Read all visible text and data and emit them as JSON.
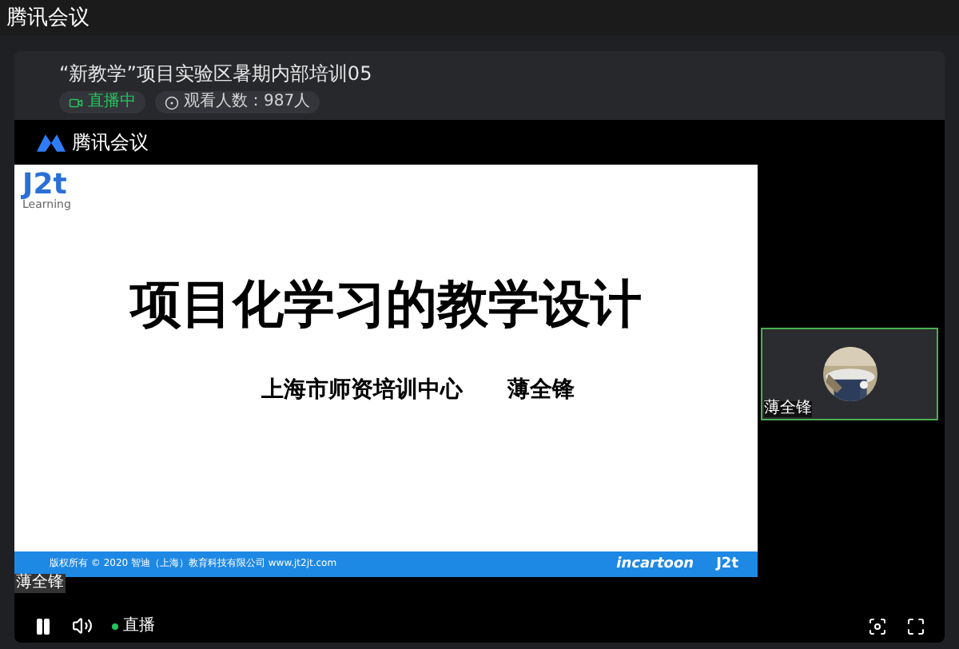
{
  "window": {
    "title": "腾讯会议"
  },
  "stream": {
    "title": "“新教学”项目实验区暑期内部培训05",
    "live_badge": "直播中",
    "viewers": "观看人数：987人"
  },
  "brand": "腾讯会议",
  "slide": {
    "logo": "J2t",
    "logo_caption": "Learning",
    "title": "项目化学习的教学设计",
    "subtitle": "上海市师资培训中心",
    "author": "薄全锋",
    "footer": "版权所有 © 2020 智迪（上海）教育科技有限公司 www.jt2jt.com",
    "footer_brand": "incartoon",
    "footer_logo": "J2t"
  },
  "speaker_label": "薄全锋",
  "participant": {
    "name": "薄全锋",
    "selected": true
  },
  "controls": {
    "status": "直播",
    "playing": true,
    "live": true
  }
}
